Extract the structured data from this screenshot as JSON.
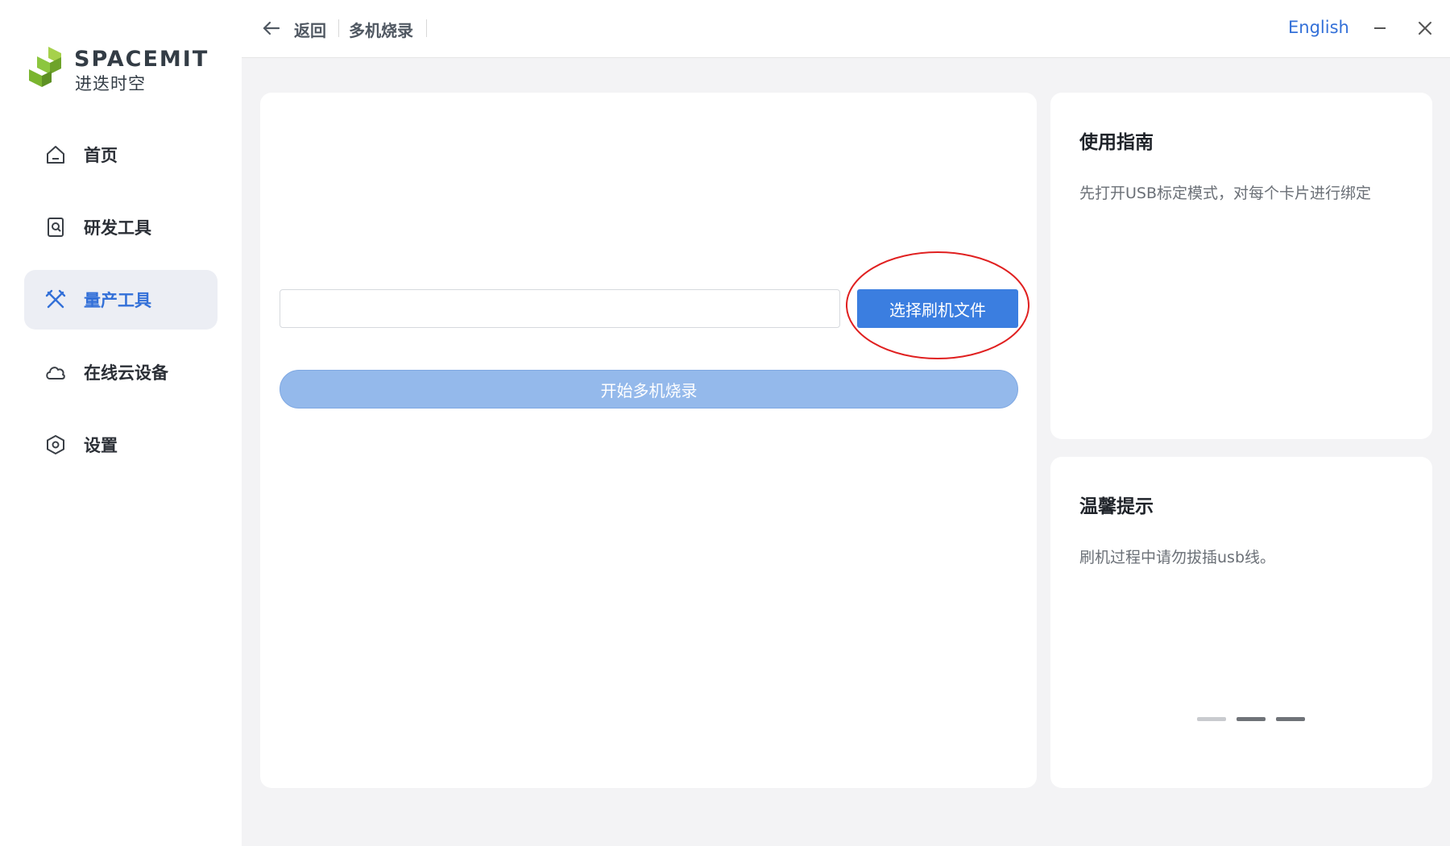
{
  "logo": {
    "brand_en": "SPACEMIT",
    "brand_cn": "进迭时空"
  },
  "sidebar": {
    "items": [
      {
        "label": "首页",
        "icon": "home-icon"
      },
      {
        "label": "研发工具",
        "icon": "dev-tool-icon"
      },
      {
        "label": "量产工具",
        "icon": "tools-icon",
        "active": true
      },
      {
        "label": "在线云设备",
        "icon": "cloud-icon"
      },
      {
        "label": "设置",
        "icon": "settings-icon"
      }
    ]
  },
  "topbar": {
    "back_label": "返回",
    "page_title": "多机烧录",
    "language": "English"
  },
  "main": {
    "file_input_value": "",
    "select_button_label": "选择刷机文件",
    "start_button_label": "开始多机烧录"
  },
  "guide": {
    "title": "使用指南",
    "text": "先打开USB标定模式，对每个卡片进行绑定"
  },
  "tips": {
    "title": "温馨提示",
    "text": "刷机过程中请勿拔插usb线。"
  },
  "colors": {
    "accent": "#3b7ee0",
    "accent_text": "#3370d8",
    "start_disabled": "#94b9eb",
    "highlight_ring": "#e02020",
    "logo_green": "#8cc63f"
  }
}
